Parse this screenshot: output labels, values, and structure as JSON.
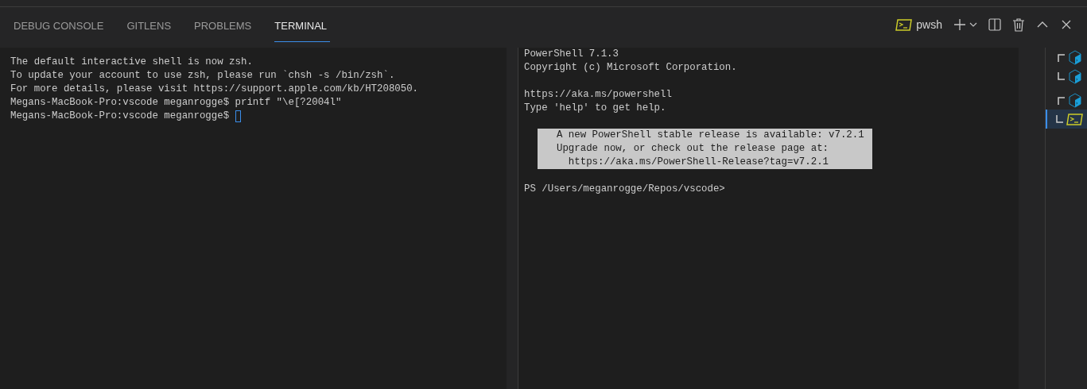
{
  "panel_tabs": [
    {
      "label": "DEBUG CONSOLE",
      "selected": false
    },
    {
      "label": "GITLENS",
      "selected": false
    },
    {
      "label": "PROBLEMS",
      "selected": false
    },
    {
      "label": "TERMINAL",
      "selected": true
    }
  ],
  "toolbar": {
    "terminal_name": "pwsh"
  },
  "terminals": [
    {
      "blocks": [
        {
          "kind": "plain",
          "lines": [
            {
              "text": "The default interactive shell is now zsh.",
              "cursor": false
            },
            {
              "text": "To update your account to use zsh, please run `chsh -s /bin/zsh`.",
              "cursor": false
            },
            {
              "text": "For more details, please visit https://support.apple.com/kb/HT208050.",
              "cursor": false
            },
            {
              "text": "Megans-MacBook-Pro:vscode meganrogge$ printf \"\\e[?2004l\"",
              "cursor": false
            },
            {
              "text": "Megans-MacBook-Pro:vscode meganrogge$ ",
              "cursor": true
            }
          ]
        }
      ]
    },
    {
      "blocks": [
        {
          "kind": "plain",
          "lines": [
            {
              "text": "PowerShell 7.1.3",
              "cursor": false
            },
            {
              "text": "Copyright (c) Microsoft Corporation.",
              "cursor": false
            }
          ]
        },
        {
          "kind": "plain",
          "lines": [
            {
              "text": "https://aka.ms/powershell",
              "cursor": false
            },
            {
              "text": "Type 'help' to get help.",
              "cursor": false
            }
          ]
        },
        {
          "kind": "notice",
          "lines": [
            {
              "text": "A new PowerShell stable release is available: v7.2.1",
              "cursor": false
            },
            {
              "text": "Upgrade now, or check out the release page at:",
              "cursor": false
            },
            {
              "text": "  https://aka.ms/PowerShell-Release?tag=v7.2.1",
              "cursor": false
            }
          ]
        },
        {
          "kind": "plain",
          "lines": [
            {
              "text": "PS /Users/meganrogge/Repos/vscode>",
              "cursor": false
            }
          ]
        }
      ]
    }
  ],
  "terminal_tabs": [
    {
      "kind": "shell",
      "group_start": true,
      "selected": false
    },
    {
      "kind": "shell",
      "group_start": false,
      "selected": false
    },
    {
      "kind": "shell",
      "group_start": true,
      "selected": false
    },
    {
      "kind": "prompt",
      "group_start": false,
      "selected": true
    }
  ]
}
